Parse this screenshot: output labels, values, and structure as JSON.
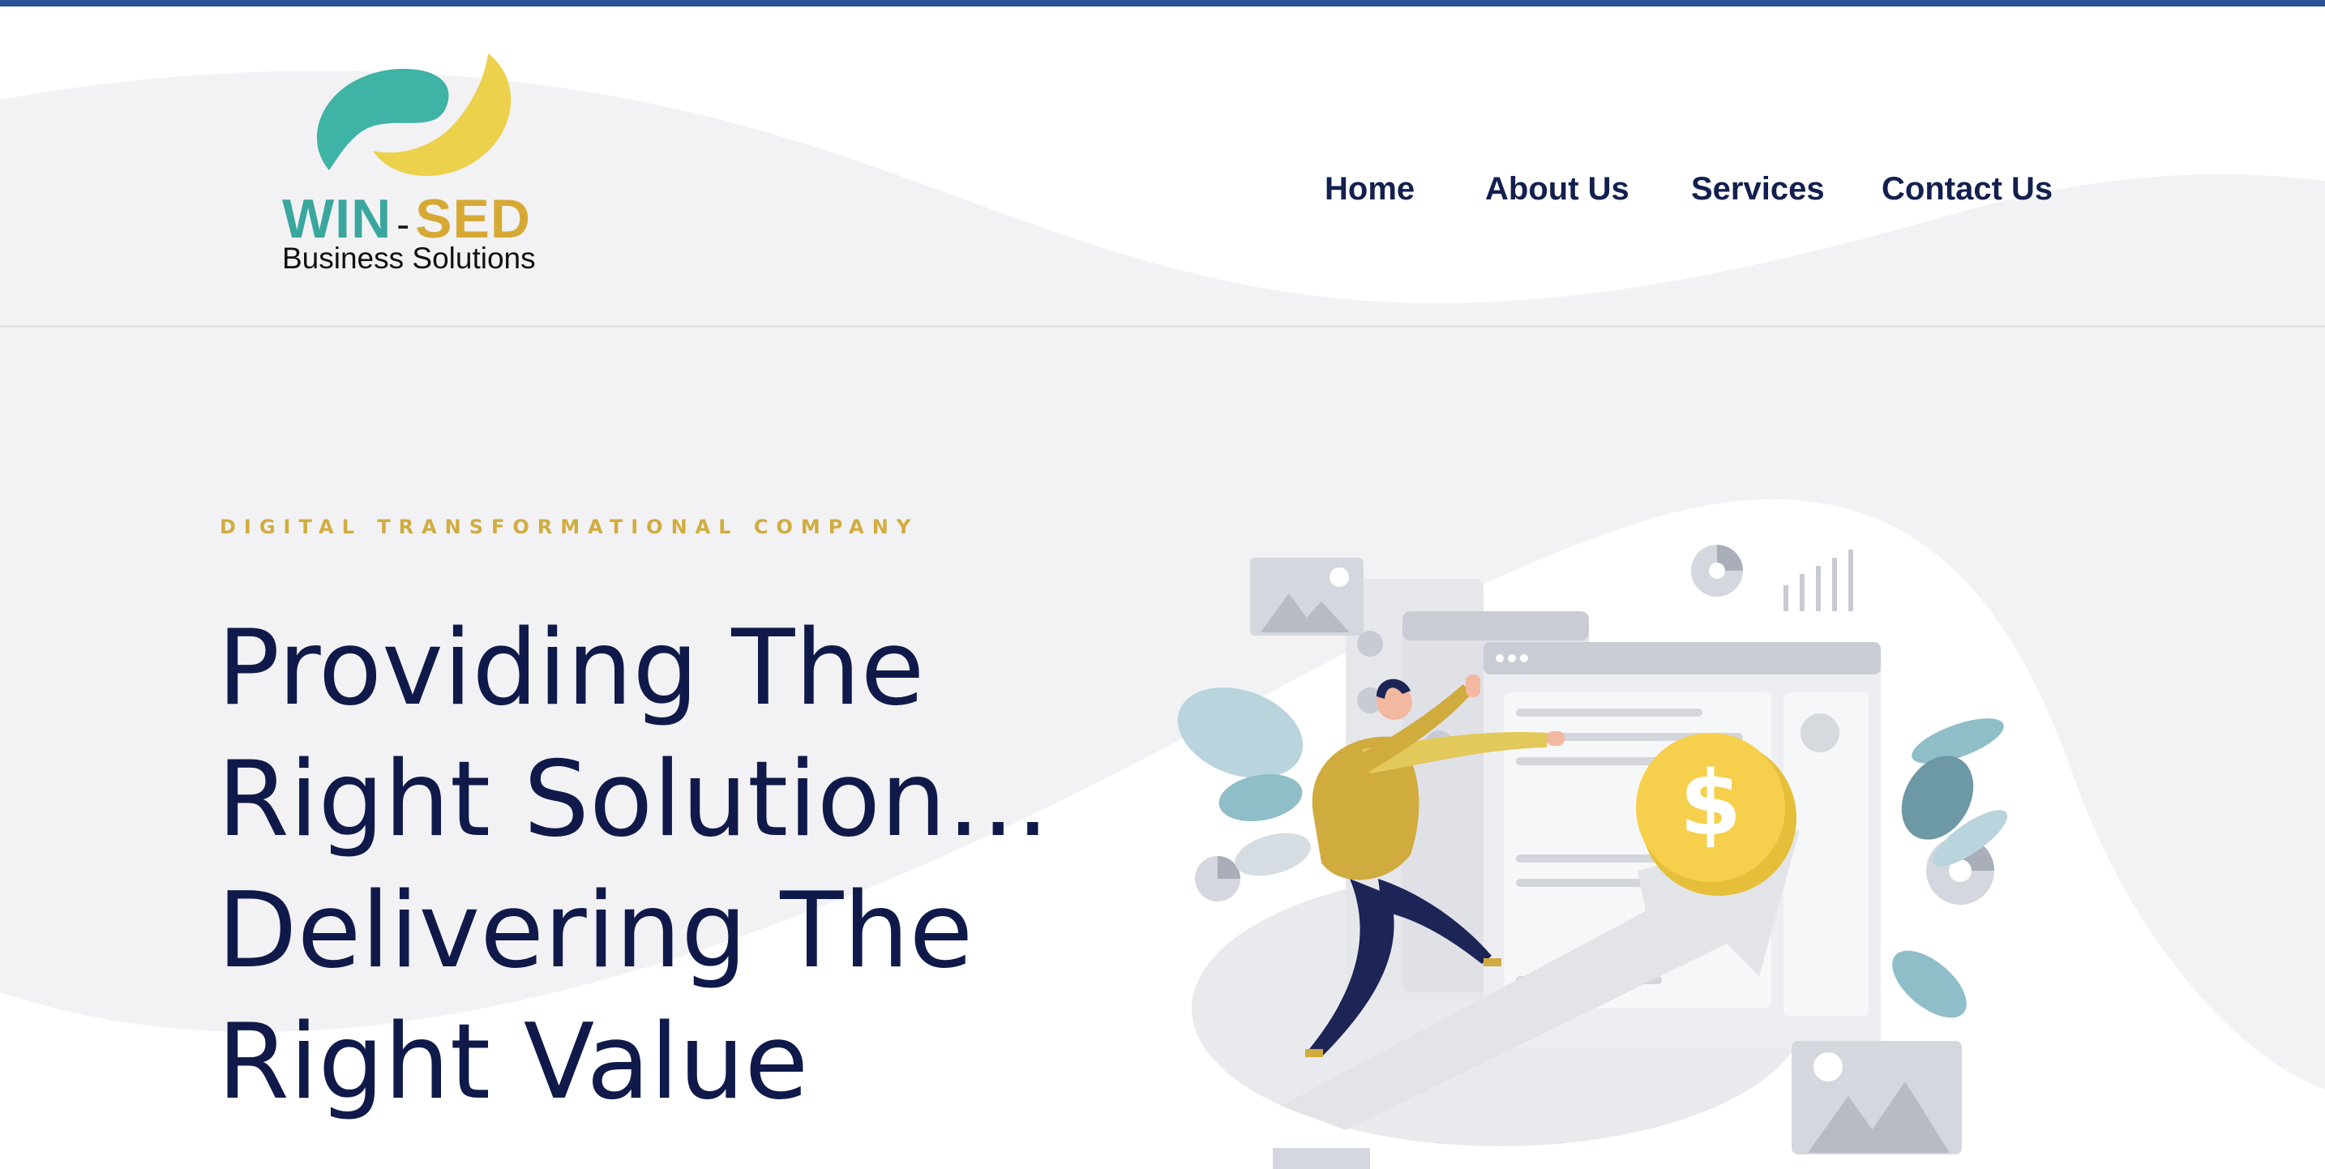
{
  "brand": {
    "name_part1": "WIN",
    "name_separator": "-",
    "name_part2": "SED",
    "tagline": "Business Solutions",
    "colors": {
      "teal": "#3aa79e",
      "gold": "#d6a934"
    }
  },
  "nav": {
    "items": [
      {
        "label": "Home"
      },
      {
        "label": "About Us"
      },
      {
        "label": "Services"
      },
      {
        "label": "Contact Us"
      }
    ],
    "color": "#13204f"
  },
  "hero": {
    "eyebrow": "DIGITAL TRANSFORMATIONAL COMPANY",
    "headline_lines": [
      "Providing The",
      "Right Solution…",
      "Delivering The",
      "Right Value"
    ],
    "headline_color": "#101a4a",
    "eyebrow_color": "#d1ac3f",
    "illustration": {
      "coin_symbol": "$",
      "icons": [
        "image-placeholder-icon",
        "pie-chart-icon",
        "bar-chart-icon",
        "dollar-coin-icon",
        "growth-arrow-icon"
      ]
    }
  },
  "accent": {
    "topbar": "#2a5294",
    "background": "#f2f2f4"
  }
}
